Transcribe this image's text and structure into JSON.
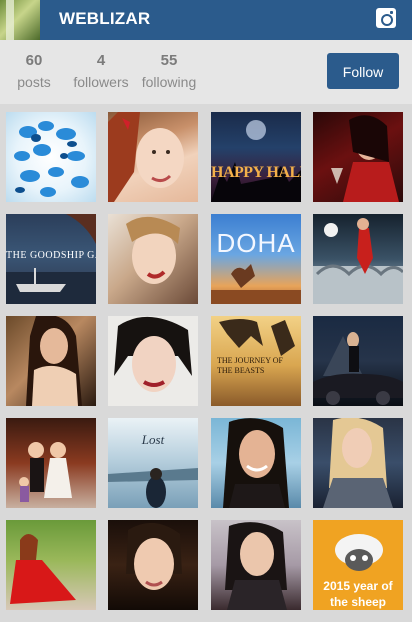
{
  "header": {
    "title": "WEBLIZAR",
    "avatar_icon": "profile-avatar",
    "instagram_icon": "instagram-icon"
  },
  "profile": {
    "posts": {
      "count": "60",
      "label": "posts"
    },
    "followers": {
      "count": "4",
      "label": "followers"
    },
    "following": {
      "count": "55",
      "label": "following"
    },
    "follow_label": "Follow"
  },
  "photos": [
    {
      "id": "butterflies",
      "caption": ""
    },
    {
      "id": "redhead-smile",
      "caption": ""
    },
    {
      "id": "halloween",
      "caption": "HAPPY HALLOWEEN"
    },
    {
      "id": "woman-red-drink",
      "caption": ""
    },
    {
      "id": "goodship-galleon",
      "caption": "THE GOODSHIP GALE"
    },
    {
      "id": "blonde-portrait",
      "caption": ""
    },
    {
      "id": "doha",
      "caption": "DOHA"
    },
    {
      "id": "soccer-player",
      "caption": ""
    },
    {
      "id": "brunette-portrait",
      "caption": ""
    },
    {
      "id": "dark-hair-portrait",
      "caption": ""
    },
    {
      "id": "journey-beasts",
      "caption": "THE JOURNEY OF THE BEASTS"
    },
    {
      "id": "car-woman-night",
      "caption": ""
    },
    {
      "id": "dolls-wedding",
      "caption": ""
    },
    {
      "id": "lost-lake",
      "caption": "Lost"
    },
    {
      "id": "brunette-smile",
      "caption": ""
    },
    {
      "id": "blonde-jacket",
      "caption": ""
    },
    {
      "id": "girl-red-dress",
      "caption": ""
    },
    {
      "id": "short-hair-portrait",
      "caption": ""
    },
    {
      "id": "girl-selfie",
      "caption": ""
    },
    {
      "id": "year-of-sheep",
      "caption": "2015 year of the sheep"
    }
  ]
}
